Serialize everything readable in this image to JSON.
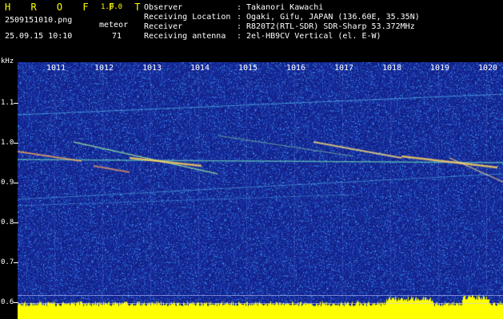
{
  "app": {
    "title": "H R O F F T",
    "version": "1.0.0"
  },
  "file": {
    "name": "2509151010.png",
    "datetime": "25.09.15 10:10"
  },
  "counter": {
    "label": "meteor",
    "value": "71"
  },
  "info": [
    {
      "key": "Observer",
      "value": "Takanori Kawachi"
    },
    {
      "key": "Receiving Location",
      "value": "Ogaki, Gifu, JAPAN (136.60E, 35.35N)"
    },
    {
      "key": "Receiver",
      "value": "R820T2(RTL-SDR) SDR-Sharp 53.372MHz"
    },
    {
      "key": "Receiving antenna",
      "value": "2el-HB9CV Vertical (el. E-W)"
    }
  ],
  "x_axis": {
    "ticks": [
      "1011",
      "1012",
      "1013",
      "1014",
      "1015",
      "1016",
      "1017",
      "1018",
      "1019",
      "1020"
    ]
  },
  "y_axis": {
    "unit": "kHz",
    "ticks": [
      "1.1",
      "1.0",
      "0.9",
      "0.8",
      "0.7",
      "0.6"
    ]
  },
  "colors": {
    "header_bg": "#000000",
    "spectrum_bg": "#1a2a9a",
    "title": "#ffff00",
    "text": "#ffffff",
    "signal": "#ffff00"
  }
}
